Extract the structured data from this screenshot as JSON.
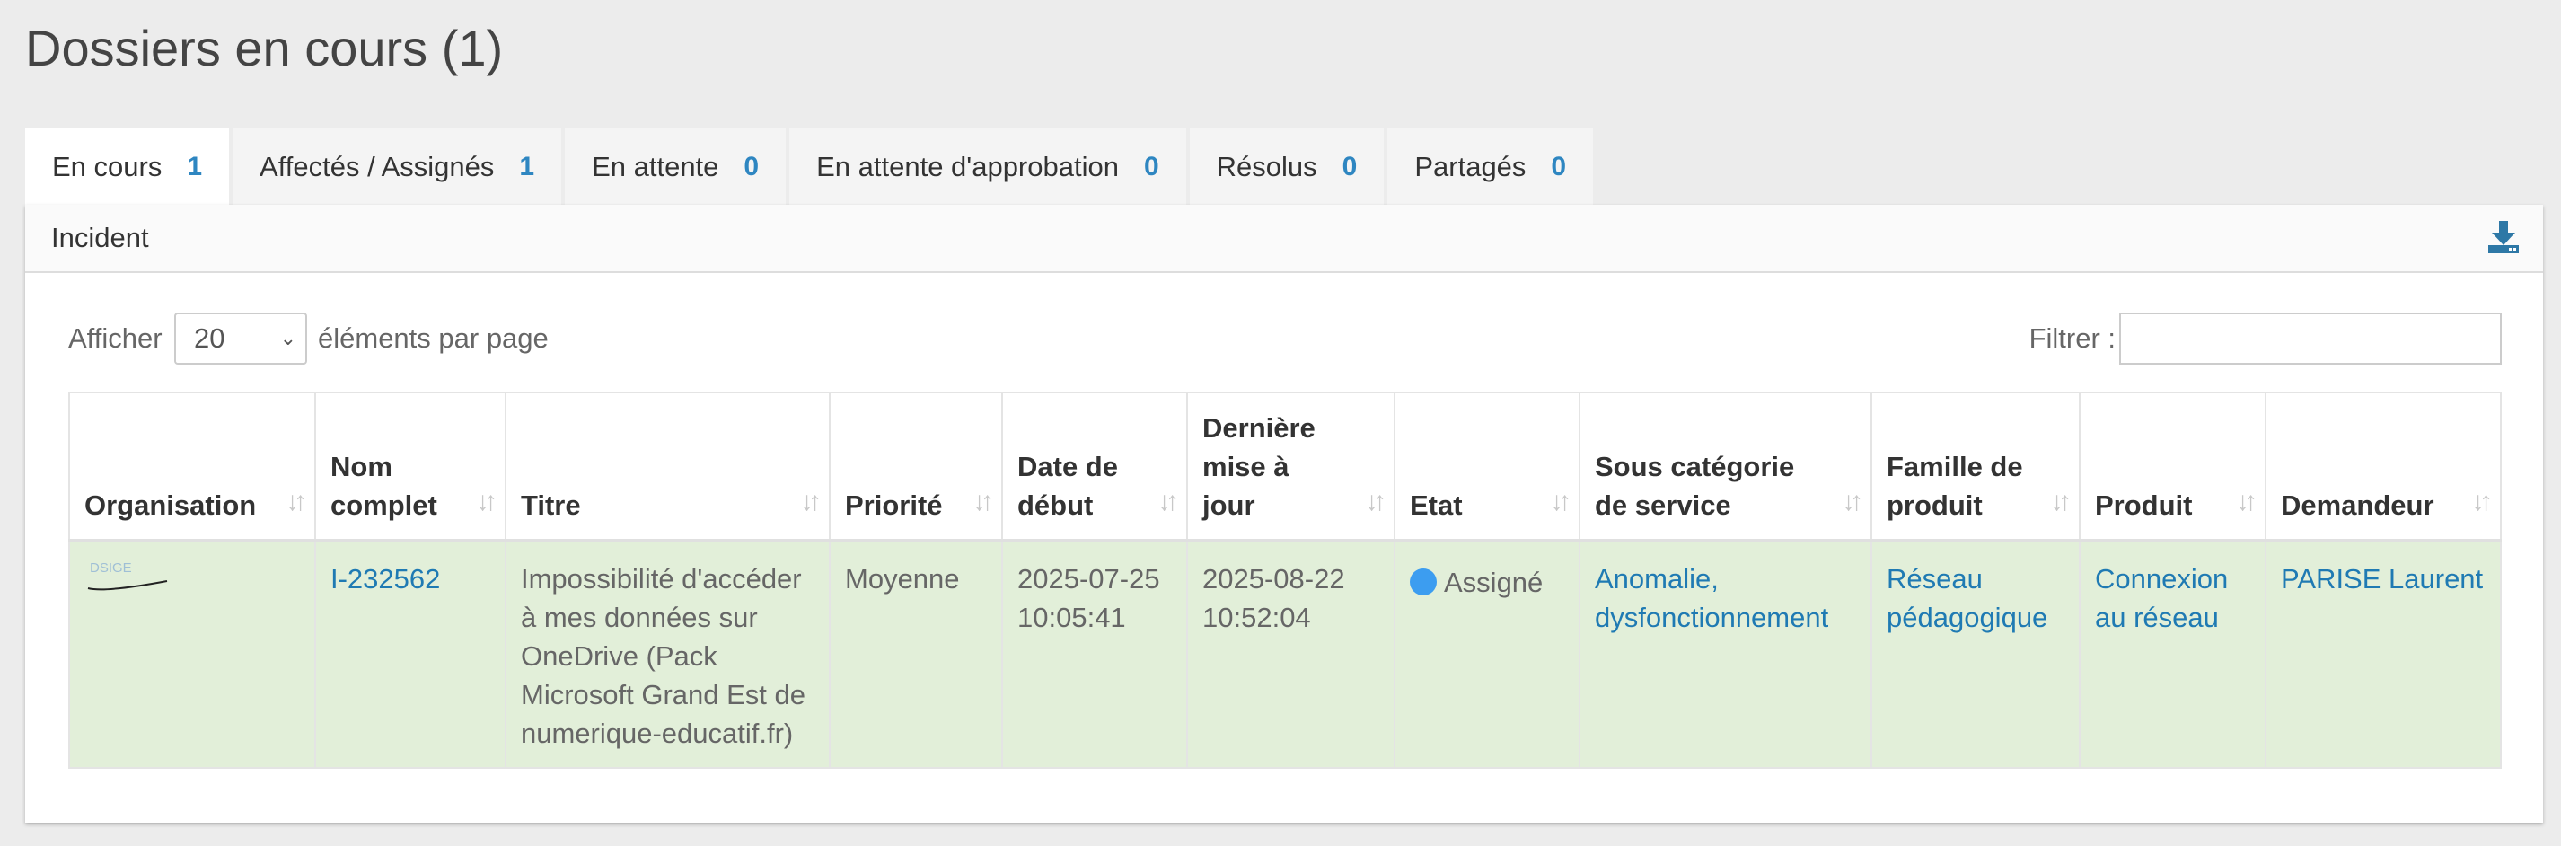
{
  "page": {
    "title": "Dossiers en cours (1)"
  },
  "tabs": [
    {
      "label": "En cours",
      "count": "1"
    },
    {
      "label": "Affectés / Assignés",
      "count": "1"
    },
    {
      "label": "En attente",
      "count": "0"
    },
    {
      "label": "En attente d'approbation",
      "count": "0"
    },
    {
      "label": "Résolus",
      "count": "0"
    },
    {
      "label": "Partagés",
      "count": "0"
    }
  ],
  "panel": {
    "header_label": "Incident",
    "download_icon": "download-icon"
  },
  "controls": {
    "show_label": "Afficher",
    "page_size": "20",
    "per_page_label": "éléments par page",
    "filter_label": "Filtrer :",
    "filter_value": ""
  },
  "table": {
    "headers": [
      "Organisation",
      "Nom complet",
      "Titre",
      "Priorité",
      "Date de début",
      "Dernière mise à jour",
      "Etat",
      "Sous catégorie de service",
      "Famille de produit",
      "Produit",
      "Demandeur"
    ],
    "rows": [
      {
        "organisation_logo": "DSIGE",
        "nom_complet": "I-232562",
        "titre": "Impossibilité d'accéder à mes données sur OneDrive (Pack Microsoft Grand Est de numerique-educatif.fr)",
        "priorite": "Moyenne",
        "date_debut": "2025-07-25 10:05:41",
        "derniere_maj": "2025-08-22 10:52:04",
        "etat": "Assigné",
        "sous_categorie": "Anomalie, dysfonctionnement",
        "famille": "Réseau pédagogique",
        "produit": "Connexion au réseau",
        "demandeur": "PARISE Laurent"
      }
    ]
  },
  "colors": {
    "accent": "#2e86c1",
    "row_highlight": "#e2efd9",
    "state_dot": "#3c9df0"
  }
}
